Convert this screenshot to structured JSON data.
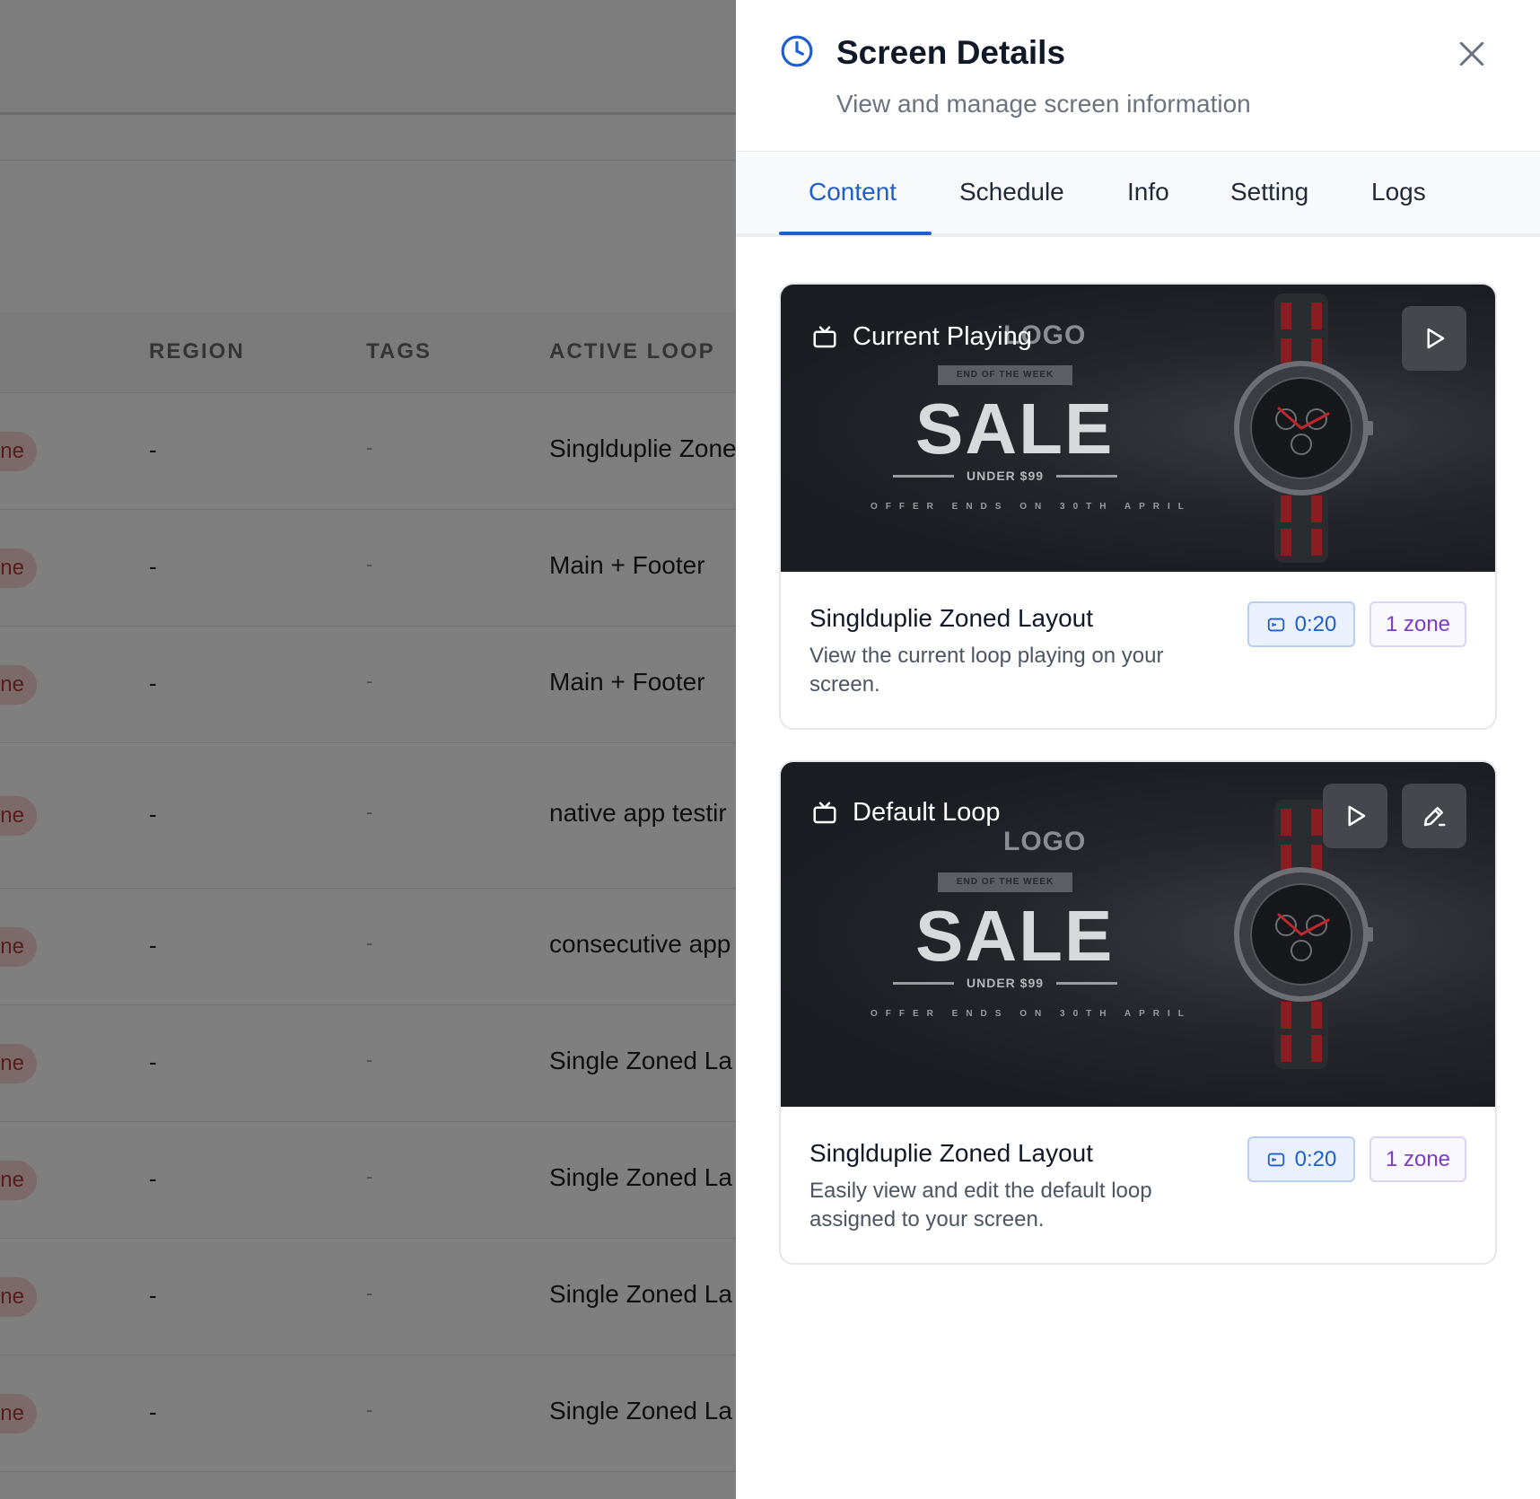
{
  "background": {
    "columns": [
      "REGION",
      "TAGS",
      "ACTIVE LOOP"
    ],
    "rows": [
      {
        "status": "ne",
        "region": "-",
        "tags": "-",
        "loop": "Singlduplie Zone"
      },
      {
        "status": "ne",
        "region": "-",
        "tags": "-",
        "loop": "Main + Footer"
      },
      {
        "status": "ne",
        "region": "-",
        "tags": "-",
        "loop": "Main + Footer"
      },
      {
        "status": "ne",
        "region": "-",
        "tags": "-",
        "loop": "native app testir"
      },
      {
        "status": "ne",
        "region": "-",
        "tags": "-",
        "loop": "consecutive app"
      },
      {
        "status": "ne",
        "region": "-",
        "tags": "-",
        "loop": "Single Zoned La"
      },
      {
        "status": "ne",
        "region": "-",
        "tags": "-",
        "loop": "Single Zoned La"
      },
      {
        "status": "ne",
        "region": "-",
        "tags": "-",
        "loop": "Single Zoned La"
      },
      {
        "status": "ne",
        "region": "-",
        "tags": "-",
        "loop": "Single Zoned La"
      }
    ]
  },
  "drawer": {
    "title": "Screen Details",
    "subtitle": "View and manage screen information",
    "icon": "clock-icon",
    "close_icon": "close-icon",
    "tabs": [
      {
        "label": "Content",
        "active": true
      },
      {
        "label": "Schedule",
        "active": false
      },
      {
        "label": "Info",
        "active": false
      },
      {
        "label": "Setting",
        "active": false
      },
      {
        "label": "Logs",
        "active": false
      }
    ],
    "accent_color": "#1d5fd1"
  },
  "ad_creative": {
    "logo": "LOGO",
    "strip": "END OF THE WEEK",
    "headline": "SALE",
    "under": "UNDER $99",
    "small": "OFFER ENDS ON 30TH APRIL"
  },
  "cards": [
    {
      "label": "Current Playing",
      "title": "Singlduplie Zoned Layout",
      "description": "View the current loop playing on your screen.",
      "duration": "0:20",
      "zones": "1 zone"
    },
    {
      "label": "Default Loop",
      "title": "Singlduplie Zoned Layout",
      "description": "Easily view and edit the default loop assigned to your screen.",
      "duration": "0:20",
      "zones": "1 zone"
    }
  ]
}
